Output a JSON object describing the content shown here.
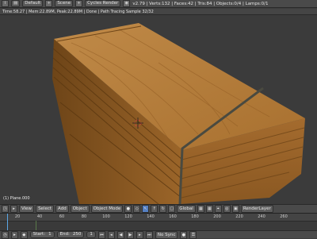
{
  "topbar": {
    "layout": "Default",
    "scene": "Scene",
    "engine": "Cycles Render",
    "stats": "v2.79 | Verts:132 | Faces:42 | Tris:84 | Objects:0/4 | Lamps:0/1"
  },
  "infobar": {
    "text": "Time:58.27 | Mem:22.89M, Peak:22.89M | Done | Path Tracing Sample 32/32"
  },
  "viewport": {
    "object_label": "(1) Plane.000"
  },
  "header3d": {
    "view": "View",
    "select": "Select",
    "add": "Add",
    "object": "Object",
    "mode": "Object Mode",
    "pivot": "Global",
    "render_layer": "RenderLayer"
  },
  "timeline": {
    "ticks": [
      "20",
      "40",
      "60",
      "80",
      "100",
      "120",
      "140",
      "160",
      "180",
      "200",
      "220",
      "240",
      "260"
    ]
  },
  "bottombar": {
    "start_label": "Start:",
    "start_value": "1",
    "end_label": "End:",
    "end_value": "250",
    "current_value": "1",
    "sync": "No Sync"
  },
  "colors": {
    "wood": "#b37a3a",
    "wood_dark": "#7a4e20",
    "strap": "#4a4a40",
    "accent": "#5680c2"
  }
}
